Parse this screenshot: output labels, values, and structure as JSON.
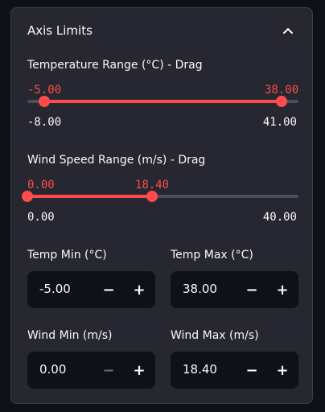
{
  "section": {
    "title": "Axis Limits",
    "collapse_icon": "chevron-up-icon"
  },
  "temp_slider": {
    "label": "Temperature Range (°C) - Drag",
    "min": -8.0,
    "max": 41.0,
    "low": -5.0,
    "high": 38.0,
    "low_label": "-5.00",
    "high_label": "38.00",
    "min_label": "-8.00",
    "max_label": "41.00"
  },
  "wind_slider": {
    "label": "Wind Speed Range (m/s) - Drag",
    "min": 0.0,
    "max": 40.0,
    "low": 0.0,
    "high": 18.4,
    "low_label": "0.00",
    "high_label": "18.40",
    "min_label": "0.00",
    "max_label": "40.00"
  },
  "inputs": {
    "temp_min": {
      "label": "Temp Min (°C)",
      "value": "-5.00"
    },
    "temp_max": {
      "label": "Temp Max (°C)",
      "value": "38.00"
    },
    "wind_min": {
      "label": "Wind Min (m/s)",
      "value": "0.00"
    },
    "wind_max": {
      "label": "Wind Max (m/s)",
      "value": "18.40"
    },
    "minus": "−",
    "plus": "+"
  },
  "colors": {
    "accent": "#ff4b4b",
    "panel_bg": "#262730",
    "input_bg": "#0e1117"
  }
}
